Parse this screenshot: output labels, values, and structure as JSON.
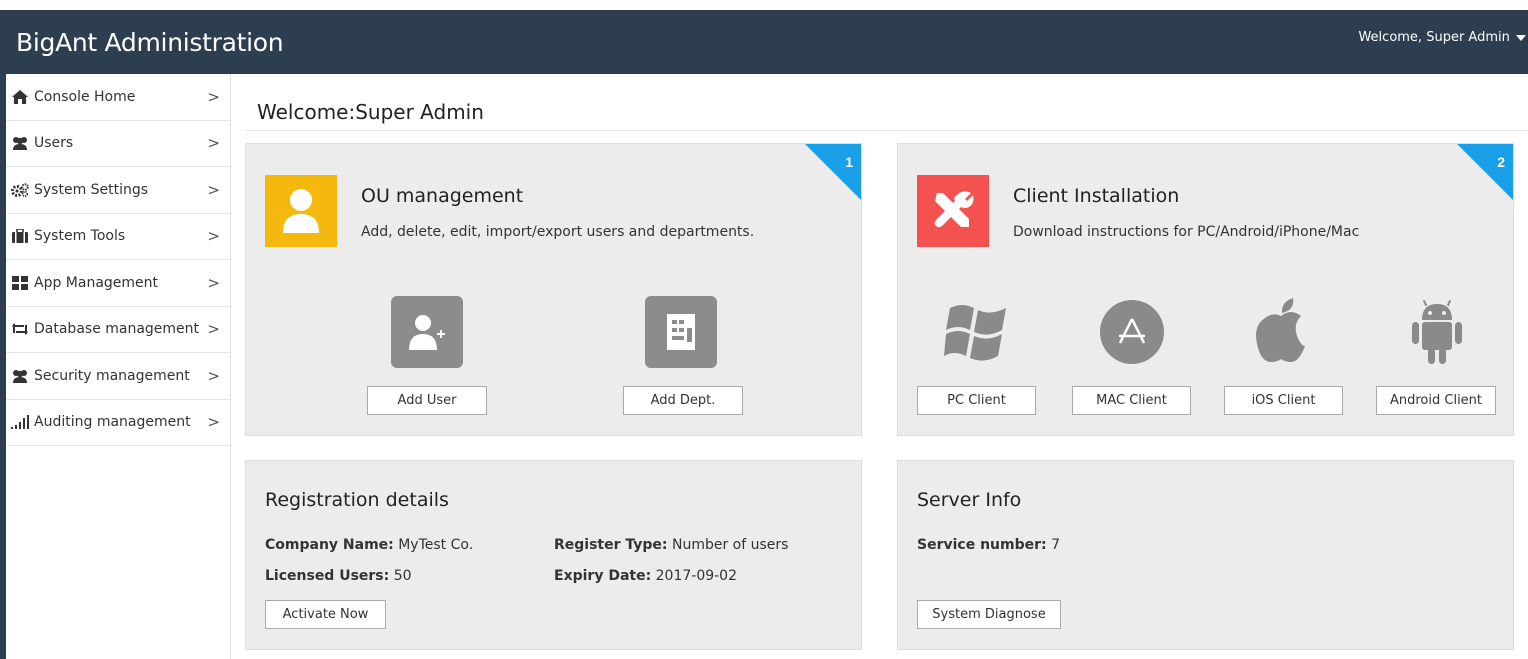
{
  "header": {
    "app_title": "BigAnt Administration",
    "welcome": "Welcome, Super Admin"
  },
  "sidebar": {
    "items": [
      {
        "label": "Console Home",
        "icon": "home-icon"
      },
      {
        "label": "Users",
        "icon": "users-icon"
      },
      {
        "label": "System Settings",
        "icon": "gears-icon"
      },
      {
        "label": "System Tools",
        "icon": "briefcase-icon"
      },
      {
        "label": "App Management",
        "icon": "grid-icon"
      },
      {
        "label": "Database management",
        "icon": "exchange-icon"
      },
      {
        "label": "Security management",
        "icon": "users-icon"
      },
      {
        "label": "Auditing management",
        "icon": "signal-bars-icon"
      }
    ],
    "chevron": ">"
  },
  "main": {
    "page_title": "Welcome:Super Admin",
    "ou_card": {
      "badge": "1",
      "title": "OU management",
      "description": "Add, delete, edit, import/export users and departments.",
      "icon_color": "#f5b80f",
      "add_user_label": "Add User",
      "add_dept_label": "Add Dept."
    },
    "client_card": {
      "badge": "2",
      "title": "Client Installation",
      "description": "Download instructions for PC/Android/iPhone/Mac",
      "icon_color": "#f45151",
      "pc_label": "PC Client",
      "mac_label": "MAC Client",
      "ios_label": "iOS Client",
      "android_label": "Android Client"
    },
    "registration": {
      "title": "Registration details",
      "company_name_key": "Company Name:",
      "company_name_value": " MyTest Co.",
      "register_type_key": "Register Type:",
      "register_type_value": " Number of users",
      "licensed_users_key": "Licensed Users:",
      "licensed_users_value": " 50",
      "expiry_date_key": "Expiry Date:",
      "expiry_date_value": " 2017-09-02",
      "activate_label": "Activate Now"
    },
    "server": {
      "title": "Server Info",
      "service_number_key": "Service number:",
      "service_number_value": " 7",
      "diagnose_label": "System Diagnose"
    }
  },
  "colors": {
    "header_bg": "#2c3e50",
    "card_bg": "#ececec",
    "badge_blue": "#1aa0e8",
    "action_icon_gray": "#8c8c8c"
  }
}
